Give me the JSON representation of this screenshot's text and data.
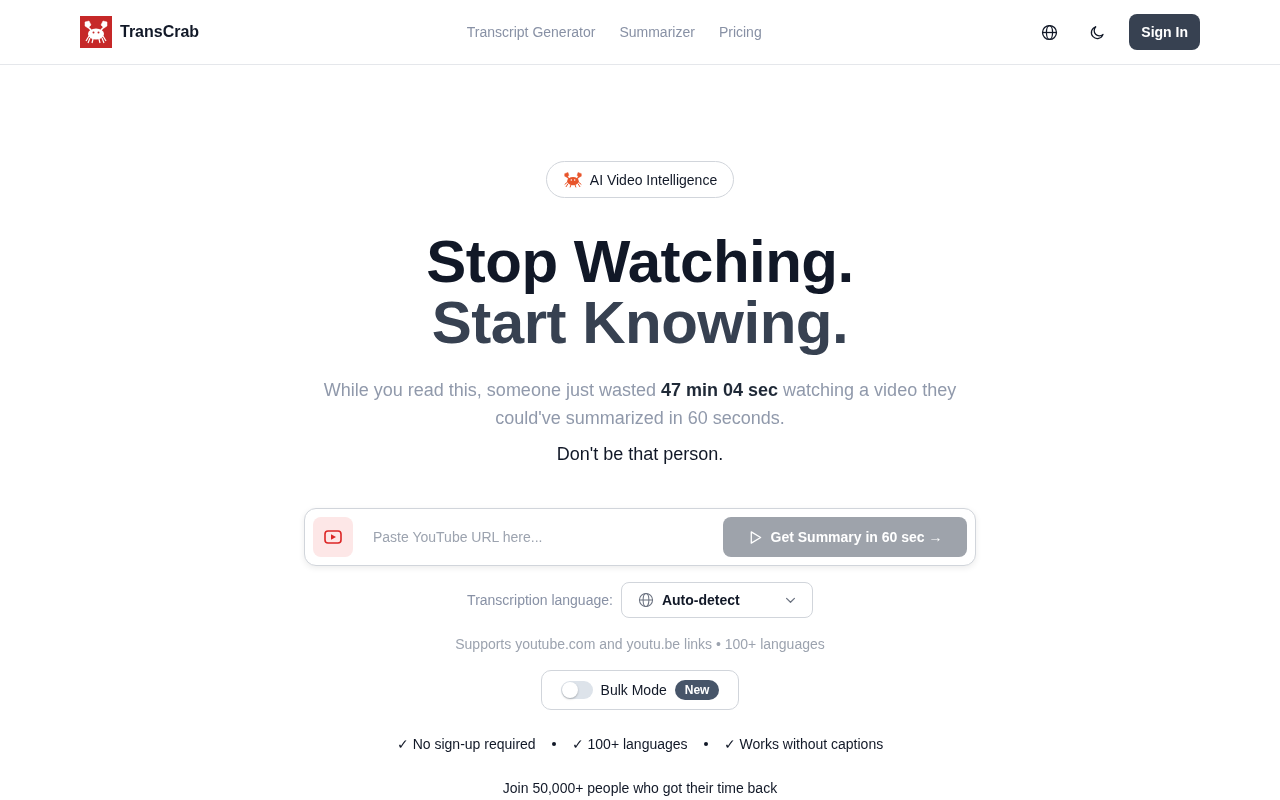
{
  "header": {
    "brand": "TransCrab",
    "nav": [
      {
        "label": "Transcript Generator"
      },
      {
        "label": "Summarizer"
      },
      {
        "label": "Pricing"
      }
    ],
    "sign_in": "Sign In"
  },
  "hero": {
    "badge": "AI Video Intelligence",
    "headline_line_1": "Stop Watching.",
    "headline_line_2": "Start Knowing.",
    "lead": "While you read this, someone just wasted **47 min 04 sec** watching a video they could've summarized in 60 seconds.",
    "punchline": "Don't be that person."
  },
  "url_form": {
    "placeholder": "Paste YouTube URL here...",
    "submit": {
      "label": "Get Summary in 60 sec →",
      "disabled": true
    }
  },
  "language": {
    "label": "Transcription language:",
    "value": "Auto-detect"
  },
  "supports_note": "Supports youtube.com and youtu.be links • 100+ languages",
  "bulk_mode": {
    "label": "Bulk Mode",
    "on": false,
    "tag": "New"
  },
  "benefits": [
    {
      "text": "✓ No sign-up required"
    },
    {
      "text": "✓ 100+ languages"
    },
    {
      "text": "✓ Works without captions"
    }
  ],
  "social_proof": "Join 50,000+ people who got their time back"
}
